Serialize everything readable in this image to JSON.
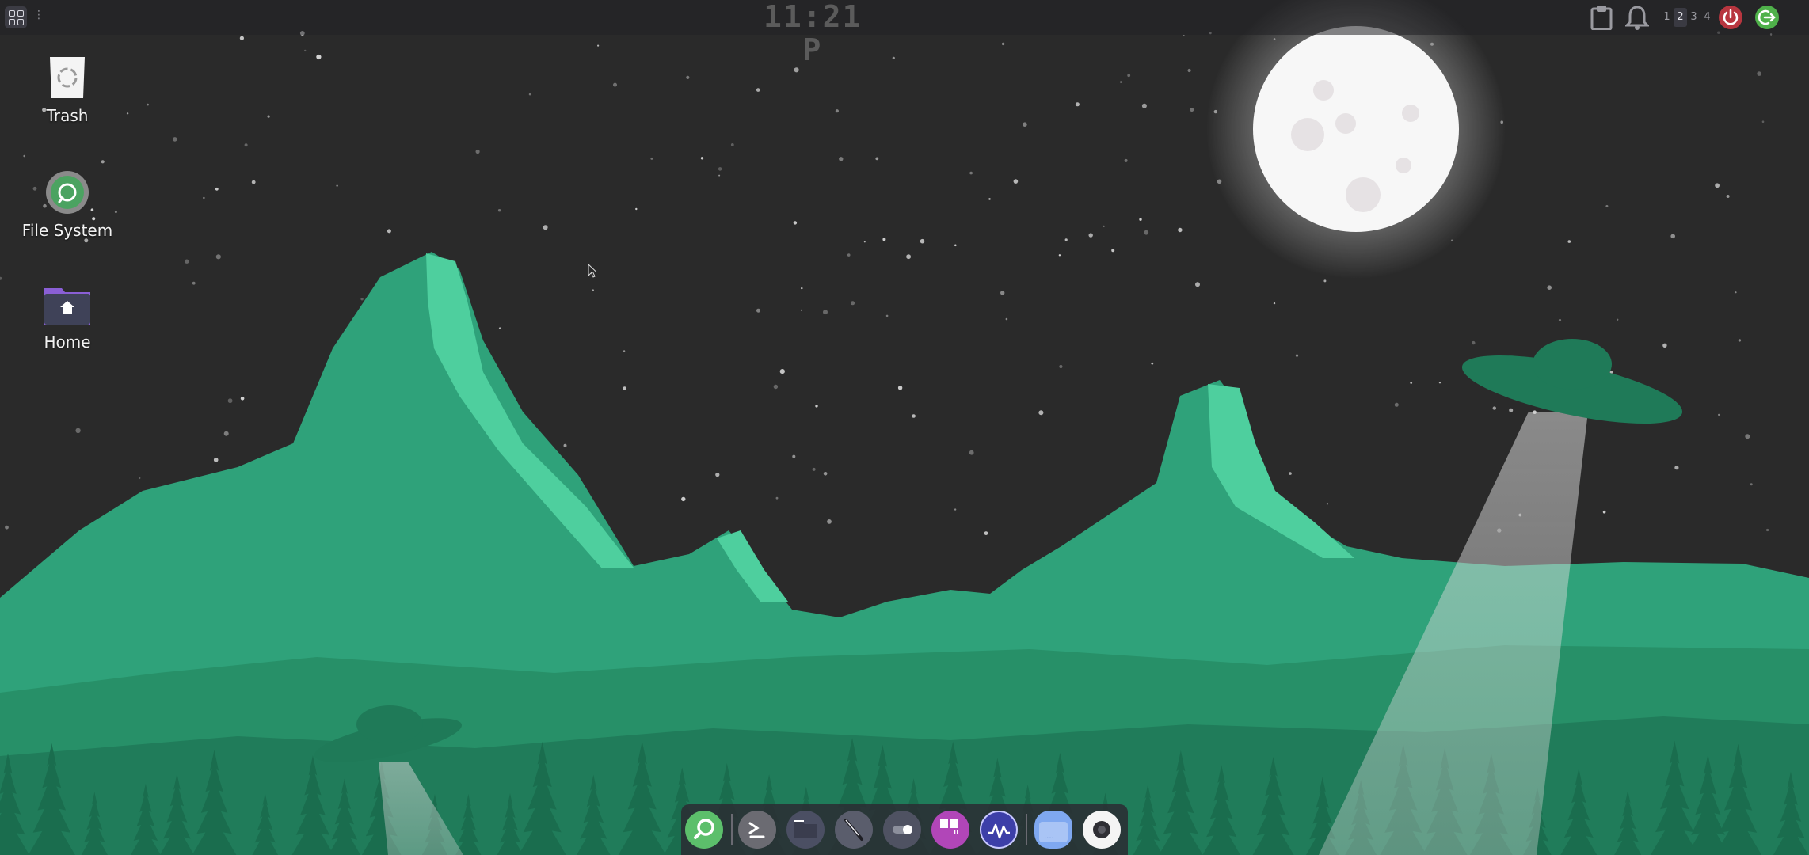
{
  "top_panel": {
    "app_menu_icon": "app-grid-icon",
    "clock": "11:21 P",
    "tray": {
      "clipboard_icon": "clipboard-icon",
      "notifications_icon": "bell-icon",
      "workspaces": [
        "1",
        "2",
        "3",
        "4"
      ],
      "active_workspace": "2",
      "power_icon": "power-icon",
      "logout_icon": "logout-icon"
    }
  },
  "desktop": {
    "icons": [
      {
        "label": "Trash",
        "icon": "trash-icon"
      },
      {
        "label": "File System",
        "icon": "drive-icon"
      },
      {
        "label": "Home",
        "icon": "home-folder-icon"
      }
    ]
  },
  "dock": {
    "items": [
      {
        "icon": "search-icon",
        "color": "#5cbf6b"
      },
      {
        "icon": "terminal-icon",
        "color": "#6b6b72"
      },
      {
        "icon": "files-icon",
        "color": "#4b4f63"
      },
      {
        "icon": "text-editor-icon",
        "color": "#5a5d6c"
      },
      {
        "icon": "settings-toggle-icon",
        "color": "#4f5262"
      },
      {
        "icon": "quotes-app-icon",
        "color": "#b146b8"
      },
      {
        "icon": "system-monitor-icon",
        "color": "#3d3fa8"
      },
      {
        "icon": "folder-app-icon",
        "color": "#7fa8f0"
      },
      {
        "icon": "camera-icon",
        "color": "#f4f4f4"
      }
    ]
  },
  "colors": {
    "sky": "#2a2a2a",
    "mountain": "#2fa27a",
    "mountain_highlight": "#4ecf9e",
    "forest": "#1f7a58",
    "moon": "#f5f5f5"
  }
}
